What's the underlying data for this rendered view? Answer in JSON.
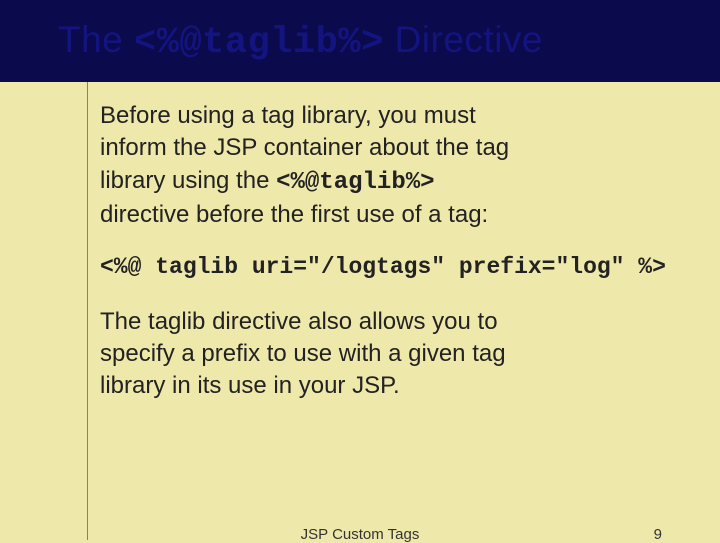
{
  "title": {
    "pre": "The ",
    "code": "<%@taglib%>",
    "post": " Directive"
  },
  "para1": {
    "l1": "Before using a tag library, you must",
    "l2": "inform the JSP container about the tag",
    "l3a": "library using the ",
    "l3code": "<%@taglib%>",
    "l4": "directive before the first use of a tag:"
  },
  "code": "<%@ taglib uri=\"/logtags\" prefix=\"log\" %>",
  "para2": {
    "l1": "The taglib directive also allows you to",
    "l2": "specify a prefix to use with a given tag",
    "l3": "library in its use in your JSP."
  },
  "footer": {
    "center": "JSP Custom Tags",
    "page": "9"
  }
}
